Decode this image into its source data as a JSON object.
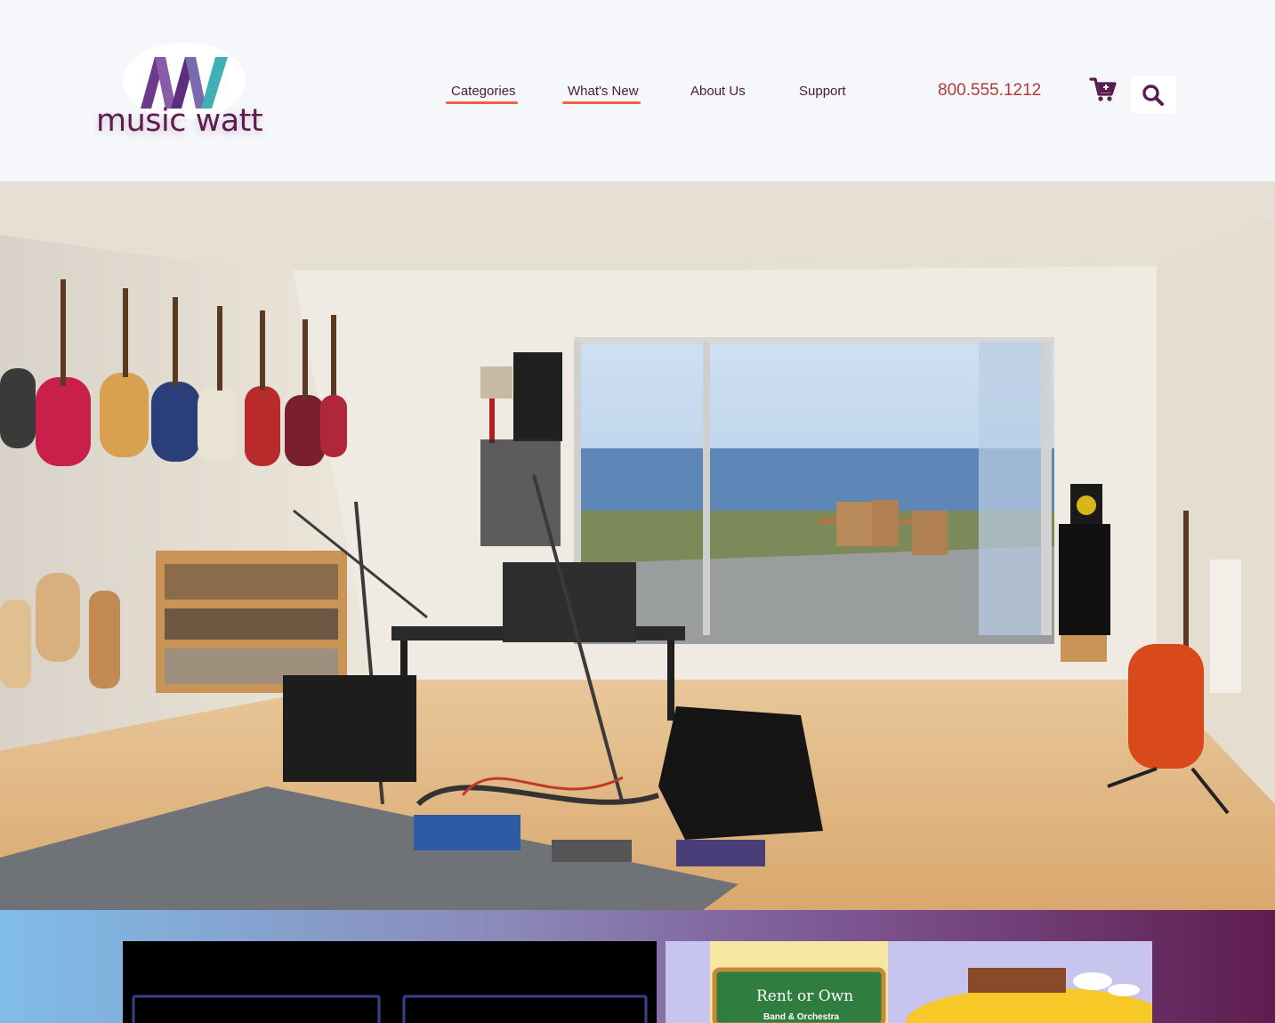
{
  "brand": {
    "name": "music watt"
  },
  "nav": {
    "items": [
      {
        "label": "Categories",
        "active": true
      },
      {
        "label": "What's New",
        "active": true
      },
      {
        "label": "About Us",
        "active": false
      },
      {
        "label": "Support",
        "active": false
      }
    ],
    "phone": "800.555.1212"
  },
  "icons": {
    "cart": "shopping-cart-icon",
    "search": "search-icon"
  },
  "hero": {
    "alt": "home music studio room with guitars on the wall"
  },
  "promos": {
    "left": {
      "alt": "promotional banner dark"
    },
    "right": {
      "sign_title": "Rent or Own",
      "sign_subtitle": "Band & Orchestra"
    }
  },
  "colors": {
    "brand_purple": "#5b1c4f",
    "accent_orange": "#f0643c",
    "phone_red": "#b23c3c",
    "header_bg": "#f6f7fa"
  }
}
